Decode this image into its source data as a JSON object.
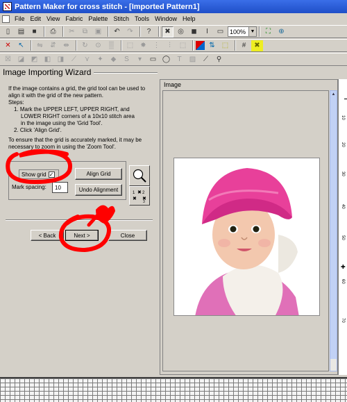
{
  "window": {
    "title": "Pattern Maker for cross stitch - [Imported Pattern1]"
  },
  "menu": [
    "File",
    "Edit",
    "View",
    "Fabric",
    "Palette",
    "Stitch",
    "Tools",
    "Window",
    "Help"
  ],
  "toolbar": {
    "zoom_value": "100%"
  },
  "wizard": {
    "title": "Image Importing Wizard",
    "intro": "If the image contains a grid, the grid tool can be used to align it with the grid of the new pattern.",
    "steps_label": "Steps:",
    "step1_a": "1. Mark the UPPER LEFT,  UPPER RIGHT, and",
    "step1_b": "LOWER RIGHT corners of a 10x10 stitch area",
    "step1_c": "in the image using the 'Grid Tool'.",
    "step2": "2. Click 'Align Grid'.",
    "note_a": "To ensure that the grid is accurately marked, it may be",
    "note_b": "necessary to zoom in using the 'Zoom Tool'.",
    "show_grid_label": "Show grid",
    "show_grid_checked": "✓",
    "align_grid_label": "Align Grid",
    "mark_spacing_label": "Mark spacing:",
    "mark_spacing_value": "10",
    "undo_alignment_label": "Undo Alignment",
    "back_label": "< Back",
    "next_label": "Next >",
    "close_label": "Close"
  },
  "image_panel": {
    "label": "Image"
  },
  "ruler": {
    "ticks": [
      "10",
      "20",
      "30",
      "40",
      "50",
      "60",
      "70"
    ]
  },
  "colors": {
    "title_bar": "#1f4fc8",
    "annotation": "#ff0000",
    "hat": "#e8409a"
  }
}
